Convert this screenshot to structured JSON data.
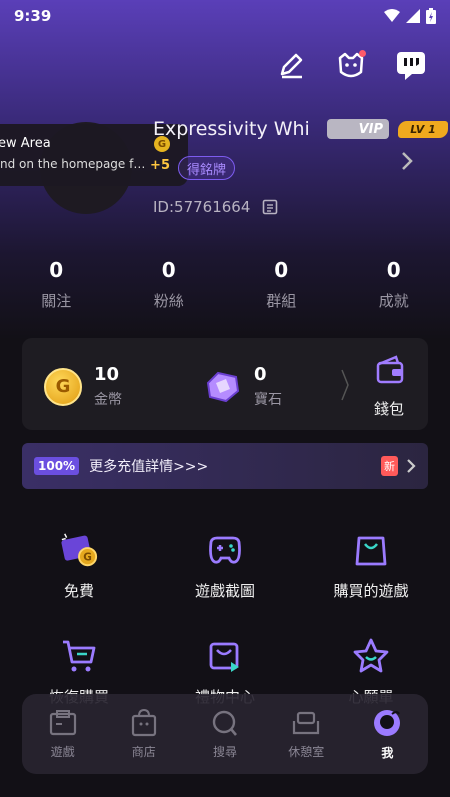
{
  "status": {
    "time": "9:39"
  },
  "profile": {
    "username": "Expressivity Whi",
    "vip_label": "VIP",
    "level_label": "LV 1",
    "medal_label": "得銘牌",
    "user_id": "ID:57761664"
  },
  "toast": {
    "title": "ew  Area",
    "message": "nd on the homepage for t...",
    "coin_icon": "G",
    "reward": "+5"
  },
  "stats": [
    {
      "value": "0",
      "label": "關注"
    },
    {
      "value": "0",
      "label": "粉絲"
    },
    {
      "value": "0",
      "label": "群組"
    },
    {
      "value": "0",
      "label": "成就"
    }
  ],
  "wallet": {
    "coins_value": "10",
    "coins_label": "金幣",
    "coin_icon": "G",
    "gems_value": "0",
    "gems_label": "寶石",
    "wallet_label": "錢包"
  },
  "promo": {
    "badge": "100%",
    "text": "更多充值詳情>>>",
    "new_badge": "新"
  },
  "grid": [
    {
      "label": "免費",
      "icon": "free-gift-icon"
    },
    {
      "label": "遊戲截圖",
      "icon": "gamepad-icon"
    },
    {
      "label": "購買的遊戲",
      "icon": "shopping-bag-icon"
    },
    {
      "label": "恢復購買",
      "icon": "cart-icon"
    },
    {
      "label": "禮物中心",
      "icon": "gift-center-icon"
    },
    {
      "label": "心願單",
      "icon": "star-icon"
    }
  ],
  "nav": [
    {
      "label": "遊戲",
      "icon": "games-icon"
    },
    {
      "label": "商店",
      "icon": "store-icon"
    },
    {
      "label": "搜尋",
      "icon": "search-icon"
    },
    {
      "label": "休憩室",
      "icon": "lounge-icon"
    },
    {
      "label": "我",
      "icon": "me-icon",
      "active": true
    }
  ]
}
